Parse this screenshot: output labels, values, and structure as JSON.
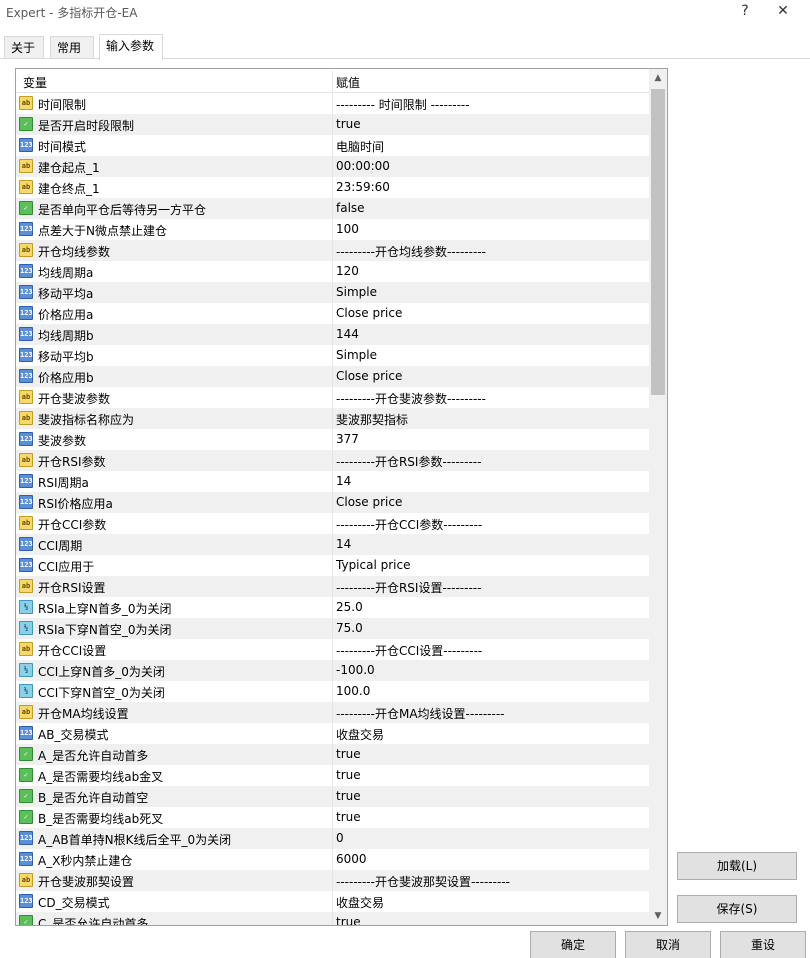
{
  "window": {
    "title": "Expert - 多指标开仓-EA",
    "help_label": "?",
    "close_label": "✕"
  },
  "tabs": [
    {
      "label": "关于",
      "active": false
    },
    {
      "label": "常用",
      "active": false
    },
    {
      "label": "输入参数",
      "active": true
    }
  ],
  "table": {
    "header_variable": "变量",
    "header_value": "赋值",
    "rows": [
      {
        "type": "string",
        "icon_text": "ab",
        "name": "时间限制",
        "value": "--------- 时间限制 ---------"
      },
      {
        "type": "bool",
        "icon_text": "✓",
        "name": "是否开启时段限制",
        "value": "true"
      },
      {
        "type": "enum",
        "icon_text": "123",
        "name": "时间模式",
        "value": "电脑时间"
      },
      {
        "type": "string",
        "icon_text": "ab",
        "name": "建仓起点_1",
        "value": "00:00:00"
      },
      {
        "type": "string",
        "icon_text": "ab",
        "name": "建仓终点_1",
        "value": "23:59:60"
      },
      {
        "type": "bool",
        "icon_text": "✓",
        "name": "是否单向平仓后等待另一方平仓",
        "value": "false"
      },
      {
        "type": "int",
        "icon_text": "123",
        "name": "点差大于N微点禁止建仓",
        "value": "100"
      },
      {
        "type": "string",
        "icon_text": "ab",
        "name": "开仓均线参数",
        "value": "---------开仓均线参数---------"
      },
      {
        "type": "int",
        "icon_text": "123",
        "name": "均线周期a",
        "value": "120"
      },
      {
        "type": "enum",
        "icon_text": "123",
        "name": "移动平均a",
        "value": "Simple"
      },
      {
        "type": "enum",
        "icon_text": "123",
        "name": "价格应用a",
        "value": "Close price"
      },
      {
        "type": "int",
        "icon_text": "123",
        "name": "均线周期b",
        "value": "144"
      },
      {
        "type": "enum",
        "icon_text": "123",
        "name": "移动平均b",
        "value": "Simple"
      },
      {
        "type": "enum",
        "icon_text": "123",
        "name": "价格应用b",
        "value": "Close price"
      },
      {
        "type": "string",
        "icon_text": "ab",
        "name": "开仓斐波参数",
        "value": "---------开仓斐波参数---------"
      },
      {
        "type": "string",
        "icon_text": "ab",
        "name": "斐波指标名称应为",
        "value": "斐波那契指标"
      },
      {
        "type": "int",
        "icon_text": "123",
        "name": "斐波参数",
        "value": "377"
      },
      {
        "type": "string",
        "icon_text": "ab",
        "name": "开仓RSI参数",
        "value": "---------开仓RSI参数---------"
      },
      {
        "type": "int",
        "icon_text": "123",
        "name": "RSI周期a",
        "value": "14"
      },
      {
        "type": "enum",
        "icon_text": "123",
        "name": "RSI价格应用a",
        "value": "Close price"
      },
      {
        "type": "string",
        "icon_text": "ab",
        "name": "开仓CCI参数",
        "value": "---------开仓CCI参数---------"
      },
      {
        "type": "int",
        "icon_text": "123",
        "name": "CCI周期",
        "value": "14"
      },
      {
        "type": "enum",
        "icon_text": "123",
        "name": "CCI应用于",
        "value": "Typical price"
      },
      {
        "type": "string",
        "icon_text": "ab",
        "name": "开仓RSI设置",
        "value": "---------开仓RSI设置---------"
      },
      {
        "type": "double",
        "icon_text": "½",
        "name": "RSIa上穿N首多_0为关闭",
        "value": "25.0"
      },
      {
        "type": "double",
        "icon_text": "½",
        "name": "RSIa下穿N首空_0为关闭",
        "value": "75.0"
      },
      {
        "type": "string",
        "icon_text": "ab",
        "name": "开仓CCI设置",
        "value": "---------开仓CCI设置---------"
      },
      {
        "type": "double",
        "icon_text": "½",
        "name": "CCI上穿N首多_0为关闭",
        "value": "-100.0"
      },
      {
        "type": "double",
        "icon_text": "½",
        "name": "CCI下穿N首空_0为关闭",
        "value": "100.0"
      },
      {
        "type": "string",
        "icon_text": "ab",
        "name": "开仓MA均线设置",
        "value": "---------开仓MA均线设置---------"
      },
      {
        "type": "enum",
        "icon_text": "123",
        "name": "AB_交易模式",
        "value": "收盘交易"
      },
      {
        "type": "bool",
        "icon_text": "✓",
        "name": "A_是否允许自动首多",
        "value": "true"
      },
      {
        "type": "bool",
        "icon_text": "✓",
        "name": "A_是否需要均线ab金叉",
        "value": "true"
      },
      {
        "type": "bool",
        "icon_text": "✓",
        "name": "B_是否允许自动首空",
        "value": "true"
      },
      {
        "type": "bool",
        "icon_text": "✓",
        "name": "B_是否需要均线ab死叉",
        "value": "true"
      },
      {
        "type": "int",
        "icon_text": "123",
        "name": "A_AB首单持N根K线后全平_0为关闭",
        "value": "0"
      },
      {
        "type": "int",
        "icon_text": "123",
        "name": "A_X秒内禁止建仓",
        "value": "6000"
      },
      {
        "type": "string",
        "icon_text": "ab",
        "name": "开仓斐波那契设置",
        "value": "---------开仓斐波那契设置---------"
      },
      {
        "type": "enum",
        "icon_text": "123",
        "name": "CD_交易模式",
        "value": "收盘交易"
      },
      {
        "type": "bool",
        "icon_text": "✓",
        "name": "C_是否允许自动首多",
        "value": "true"
      }
    ]
  },
  "side_buttons": {
    "load": "加载(L)",
    "save": "保存(S)"
  },
  "bottom_buttons": {
    "ok": "确定",
    "cancel": "取消",
    "reset": "重设"
  },
  "scrollbar": {
    "up_arrow": "▲",
    "down_arrow": "▼"
  },
  "colors": {
    "row_alt": "#f0f0f0",
    "string_icon": "#f6d96a",
    "bool_icon": "#5bbf5b",
    "int_icon": "#5b8fd6",
    "double_icon": "#8ad0e8"
  }
}
